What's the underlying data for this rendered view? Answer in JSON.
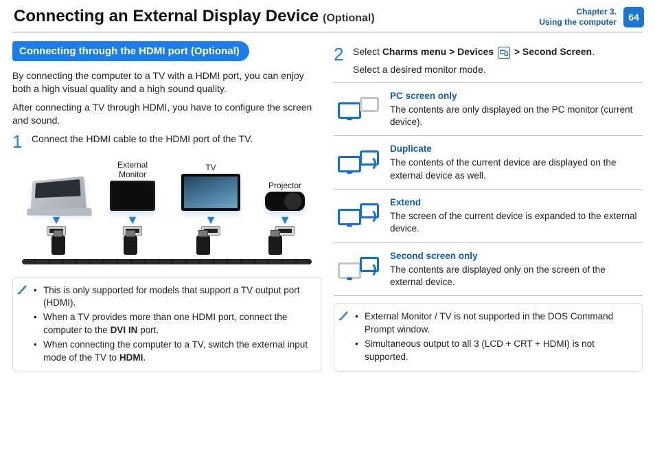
{
  "header": {
    "title": "Connecting an External Display Device",
    "optional": "(Optional)",
    "chapter_line1": "Chapter 3.",
    "chapter_line2": "Using the computer",
    "page_number": "64"
  },
  "left": {
    "ribbon": "Connecting through the HDMI port (Optional)",
    "para1": "By connecting the computer to a TV with a HDMI port, you can enjoy both a high visual quality and a high sound quality.",
    "para2": "After connecting a TV through HDMI, you have to configure the screen and sound.",
    "step1_num": "1",
    "step1_text": "Connect the HDMI cable to the HDMI port of the TV.",
    "diagram": {
      "external_monitor": "External Monitor",
      "tv": "TV",
      "projector": "Projector"
    },
    "notes": {
      "n1": "This is only supported for models that support a TV output port (HDMI).",
      "n2_pre": "When a TV provides more than one HDMI port, connect the computer to the ",
      "n2_bold": "DVI IN",
      "n2_post": " port.",
      "n3_pre": "When connecting the computer to a TV, switch the external input mode of the TV to ",
      "n3_bold": "HDMI",
      "n3_post": "."
    }
  },
  "right": {
    "step2_num": "2",
    "step2_a": "Select ",
    "step2_b1": "Charms menu > Devices",
    "step2_mid": " > ",
    "step2_b2": "Second Screen",
    "step2_period": ".",
    "step2_line2": "Select a desired monitor mode.",
    "modes": {
      "m1_title": "PC screen only",
      "m1_desc": "The contents are only displayed on the PC monitor (current device).",
      "m2_title": "Duplicate",
      "m2_desc": "The contents of the current device are displayed on the external device as well.",
      "m3_title": "Extend",
      "m3_desc": "The screen of the current device is expanded to the external device.",
      "m4_title": "Second screen only",
      "m4_desc": "The contents are displayed only on the screen of the external device."
    },
    "notes": {
      "r1": "External Monitor / TV is not supported in the DOS Command Prompt window.",
      "r2": "Simultaneous output to all 3 (LCD + CRT + HDMI) is not supported."
    }
  }
}
